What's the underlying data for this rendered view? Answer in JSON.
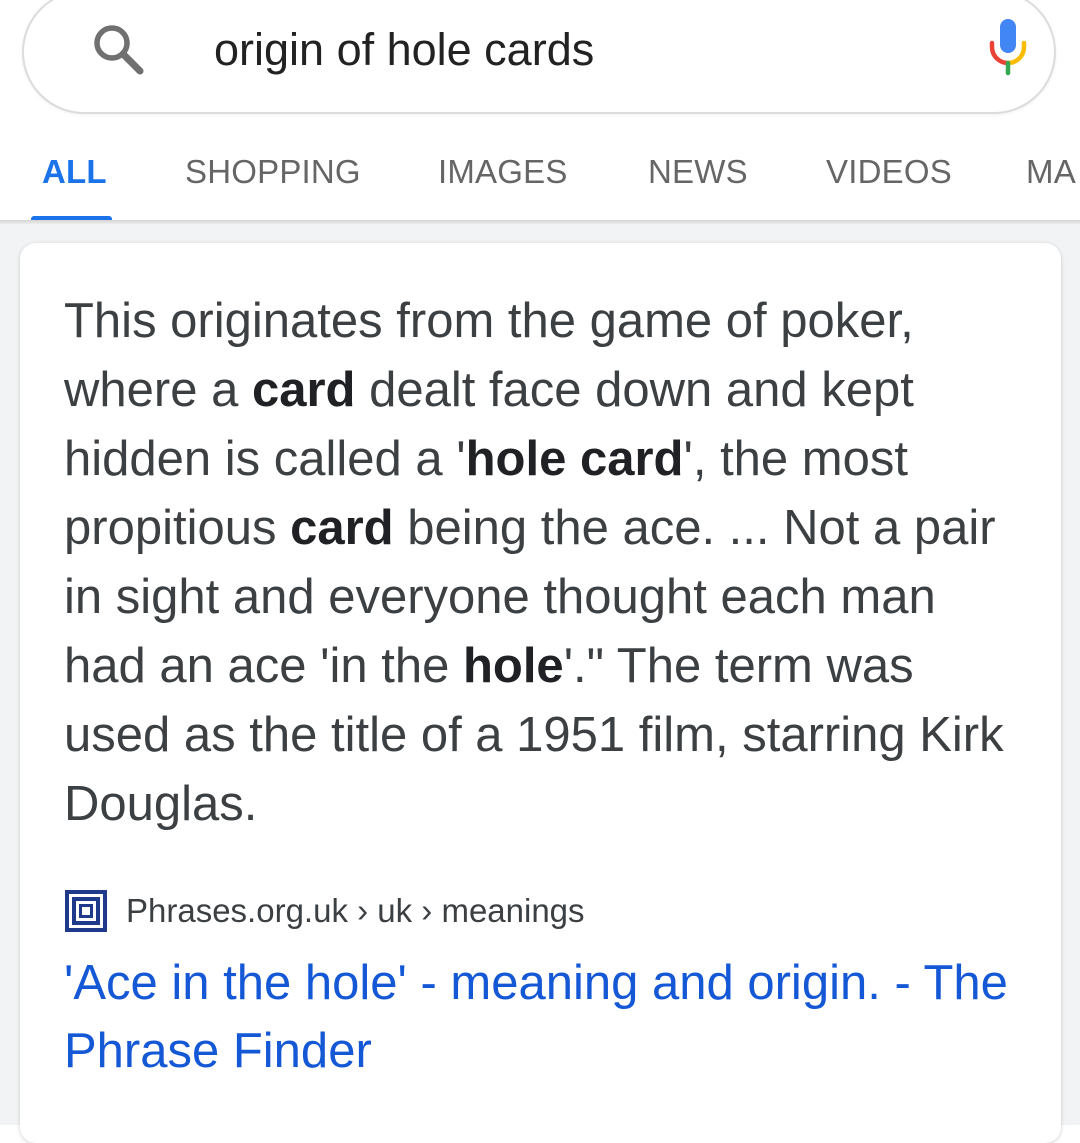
{
  "search": {
    "query": "origin of hole cards"
  },
  "tabs": [
    "ALL",
    "SHOPPING",
    "IMAGES",
    "NEWS",
    "VIDEOS",
    "MA"
  ],
  "snippet": {
    "segments": [
      {
        "text": "This originates from the game of poker, where a ",
        "bold": false
      },
      {
        "text": "card",
        "bold": true
      },
      {
        "text": " dealt face down and kept hidden is called a '",
        "bold": false
      },
      {
        "text": "hole card",
        "bold": true
      },
      {
        "text": "', the most propitious ",
        "bold": false
      },
      {
        "text": "card",
        "bold": true
      },
      {
        "text": " being the ace. ... Not a pair in sight and everyone thought each man had an ace 'in the ",
        "bold": false
      },
      {
        "text": "hole",
        "bold": true
      },
      {
        "text": "'.\" The term was used as the title of a 1951 film, starring Kirk Douglas.",
        "bold": false
      }
    ]
  },
  "source": {
    "breadcrumb": "Phrases.org.uk › uk › meanings",
    "favicon": "phrase-finder-favicon"
  },
  "result": {
    "title": "'Ace in the hole' - meaning and origin. - The Phrase Finder"
  },
  "colors": {
    "accent": "#1a73e8",
    "link": "#1558d6",
    "text": "#3c4043",
    "tab_inactive": "#666666"
  }
}
